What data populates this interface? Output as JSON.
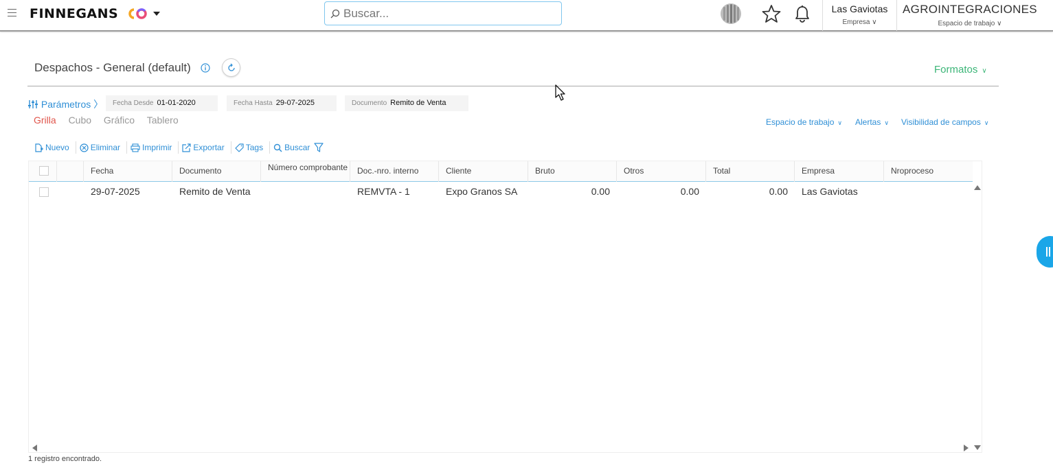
{
  "app": {
    "brand": "FINNEGANS",
    "search_placeholder": "Buscar...",
    "company": {
      "name": "Las Gaviotas",
      "label": "Empresa"
    },
    "workspace": {
      "name": "AGROINTEGRACIONES",
      "label": "Espacio de trabajo"
    }
  },
  "page": {
    "title": "Despachos - General (default)",
    "formats_label": "Formatos"
  },
  "params": {
    "toggle_label": "Parámetros",
    "fields": [
      {
        "label": "Fecha Desde",
        "value": "01-01-2020"
      },
      {
        "label": "Fecha Hasta",
        "value": "29-07-2025"
      },
      {
        "label": "Documento",
        "value": "Remito de Venta"
      }
    ]
  },
  "view_tabs": [
    "Grilla",
    "Cubo",
    "Gráfico",
    "Tablero"
  ],
  "active_view": "Grilla",
  "right_links": [
    "Espacio de trabajo",
    "Alertas",
    "Visibilidad de campos"
  ],
  "toolbar": {
    "new": "Nuevo",
    "delete": "Eliminar",
    "print": "Imprimir",
    "export": "Exportar",
    "tags": "Tags",
    "search": "Buscar"
  },
  "grid": {
    "columns": [
      "Fecha",
      "Documento",
      "Número comprobante",
      "Doc.-nro. interno",
      "Cliente",
      "Bruto",
      "Otros",
      "Total",
      "Empresa",
      "Nroproceso"
    ],
    "rows": [
      {
        "fecha": "29-07-2025",
        "documento": "Remito de Venta",
        "numero_comprobante": "",
        "doc_nro_interno": "REMVTA - 1",
        "cliente": "Expo Granos SA",
        "bruto": "0.00",
        "otros": "0.00",
        "total": "0.00",
        "empresa": "Las Gaviotas",
        "nroproceso": ""
      }
    ]
  },
  "status": "1 registro encontrado.",
  "colors": {
    "accent_blue": "#2f8fd6",
    "formats_green": "#3bb577",
    "active_tab_red": "#e0554b",
    "side_handle": "#1aa6e8"
  },
  "icons": [
    "menu-icon",
    "search-icon",
    "voice-orb-icon",
    "star-icon",
    "bell-icon",
    "info-icon",
    "refresh-icon",
    "sliders-icon",
    "new-doc-icon",
    "delete-icon",
    "print-icon",
    "export-icon",
    "tag-icon",
    "filter-icon"
  ]
}
